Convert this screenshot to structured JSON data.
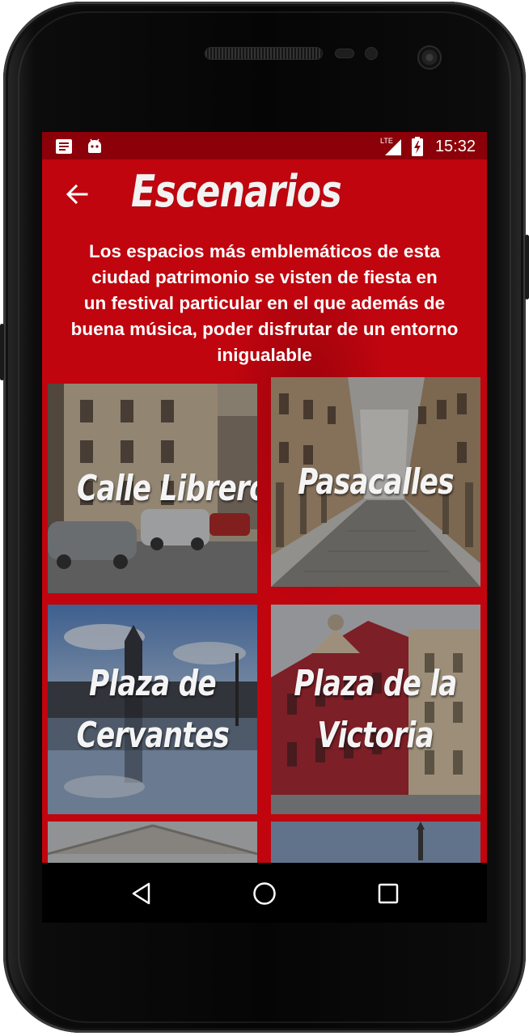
{
  "status_bar": {
    "time": "15:32",
    "network": "LTE",
    "left_icons": [
      "notes-icon",
      "android-icon"
    ],
    "right_icons": [
      "signal-icon",
      "battery-charging-icon"
    ]
  },
  "header": {
    "title": "Escenarios",
    "back_icon": "arrow-back-icon"
  },
  "intro": {
    "lines": [
      "Los espacios más emblemáticos de esta",
      "ciudad patrimonio se visten de fiesta en",
      "un festival particular en el que además de",
      "buena música, poder disfrutar de un entorno",
      "inigualable"
    ]
  },
  "venues": [
    {
      "lines": [
        "Calle Libreros"
      ]
    },
    {
      "lines": [
        "Pasacalles"
      ]
    },
    {
      "lines": [
        "Plaza de",
        "Cervantes"
      ]
    },
    {
      "lines": [
        "Plaza de la",
        "Victoria"
      ]
    },
    {
      "lines": [
        ""
      ]
    },
    {
      "lines": [
        ""
      ]
    }
  ],
  "nav_bar": {
    "icons": [
      "back-triangle-icon",
      "home-circle-icon",
      "recents-square-icon"
    ]
  },
  "colors": {
    "app_background": "#c0050f",
    "status_bar": "#8c0009",
    "text": "#ffffff"
  }
}
